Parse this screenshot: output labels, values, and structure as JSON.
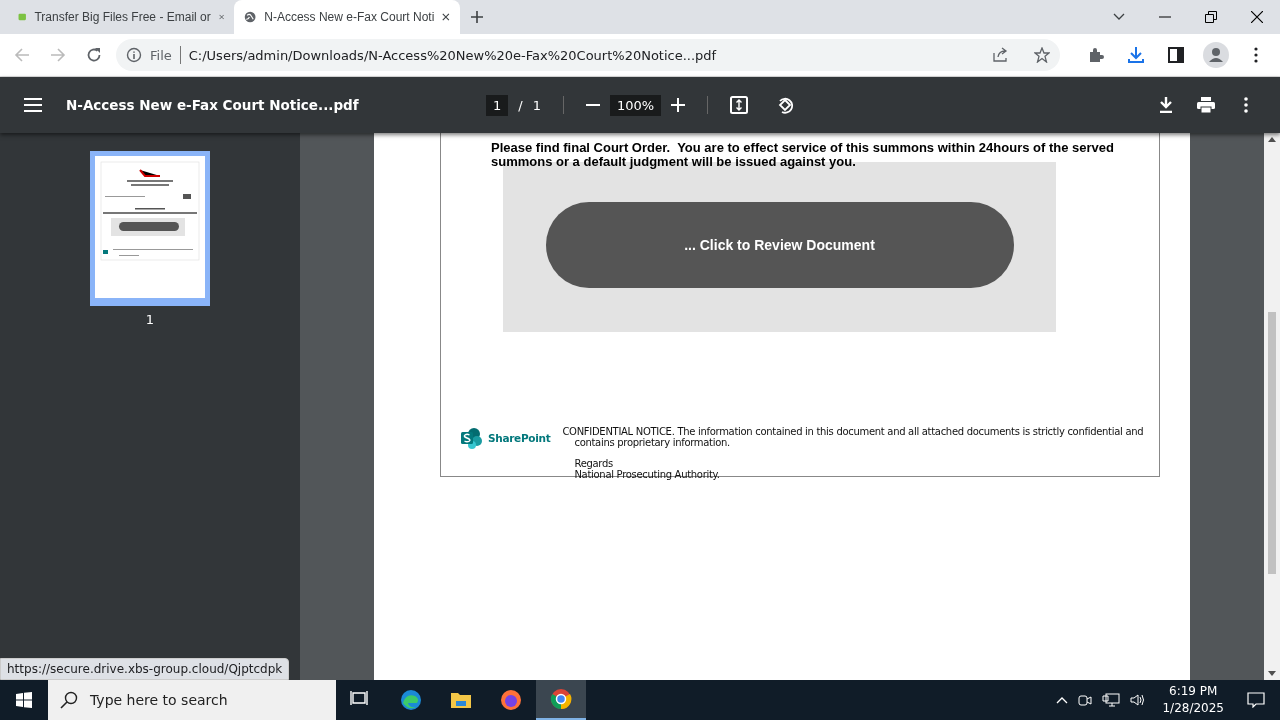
{
  "tabs": [
    {
      "title": "Transfer Big Files Free - Email or",
      "kind": "bigfiles",
      "selected": false
    },
    {
      "title": "N-Access New e-Fax Court Noti",
      "kind": "globe",
      "selected": true
    }
  ],
  "address": {
    "scheme": "File",
    "url": "C:/Users/admin/Downloads/N-Access%20New%20e-Fax%20Court%20Notice...pdf"
  },
  "pdf_toolbar": {
    "title": "N-Access New e-Fax Court Notice...pdf",
    "page": "1",
    "separator": "/",
    "pages": "1",
    "zoom": "100%"
  },
  "thumbnails": [
    {
      "label": "1",
      "selected": true
    }
  ],
  "document": {
    "heading": "Please find final Court Order.  You are to effect service of this summons within 24hours of the served summons or a default judgment will be issued against you.",
    "button": "... Click to Review Document",
    "logo_text": "SharePoint",
    "notice": "CONFIDENTIAL NOTICE. The information contained in this document and all attached documents is strictly confidential and contains proprietary information.",
    "regards": "Regards",
    "signature": "National Prosecuting Authority."
  },
  "status_url": "https://secure.drive.xbs-group.cloud/Qjptcdpk",
  "taskbar": {
    "search_placeholder": "Type here to search",
    "apps": [
      {
        "kind": "taskview",
        "selected": false
      },
      {
        "kind": "edge",
        "selected": false
      },
      {
        "kind": "explorer",
        "selected": false
      },
      {
        "kind": "firefox",
        "selected": false
      },
      {
        "kind": "chrome",
        "selected": true
      }
    ],
    "time": "6:19 PM",
    "date": "1/28/2025"
  }
}
